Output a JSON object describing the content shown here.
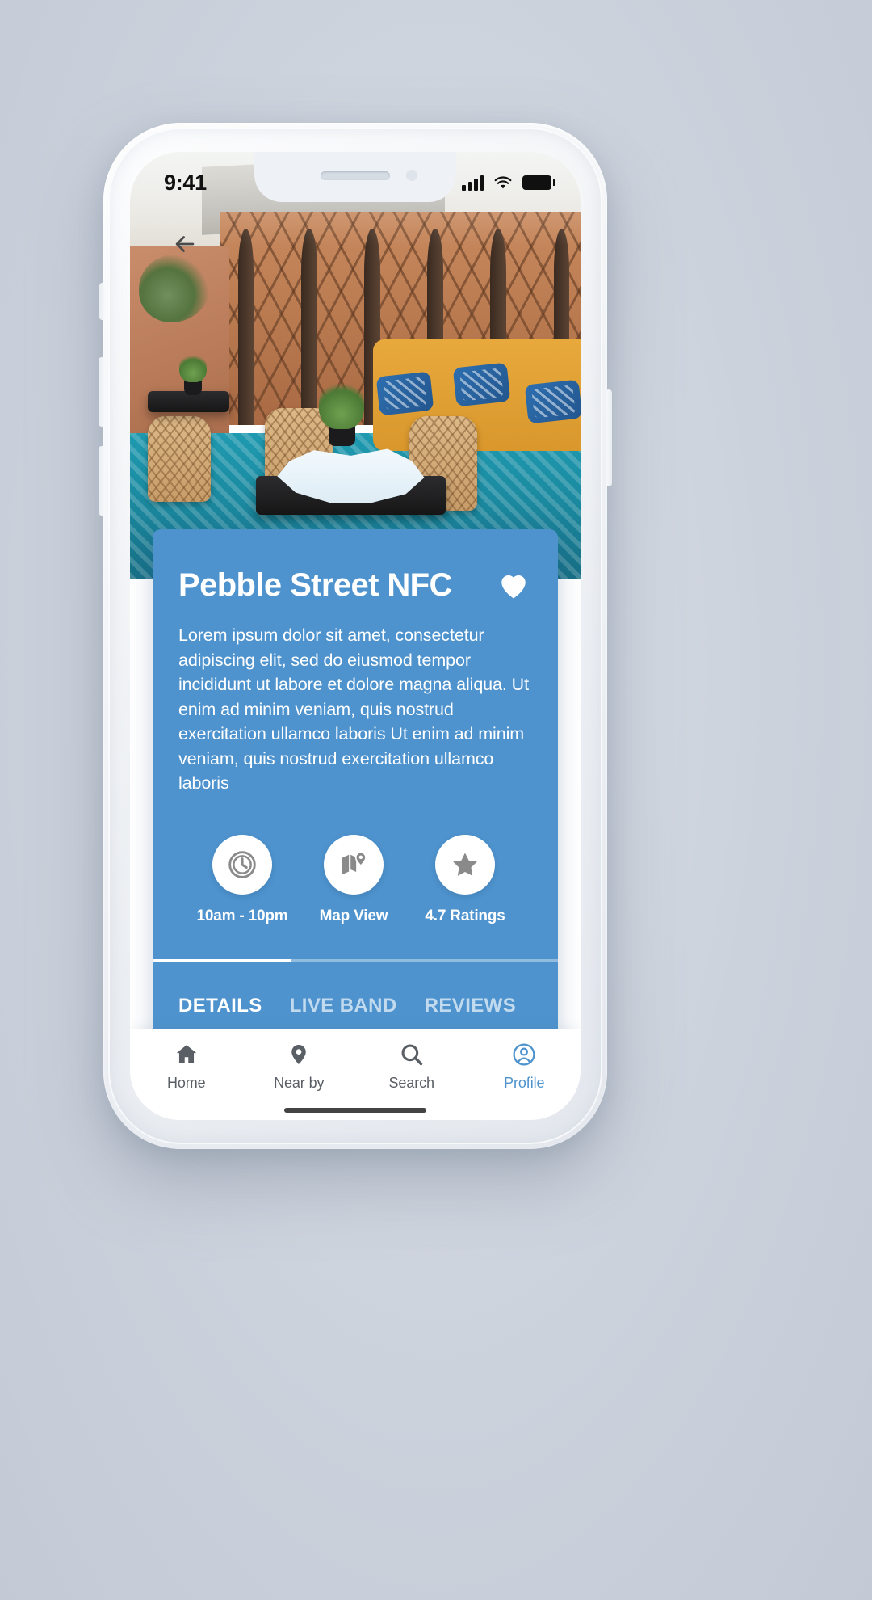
{
  "status_bar": {
    "time": "9:41",
    "icons": [
      "signal-bars-icon",
      "wifi-icon",
      "battery-icon"
    ]
  },
  "header": {
    "back_icon": "arrow-left-icon"
  },
  "hero": {
    "image_alt": "restaurant terrace with rattan chairs, blue pillows and patterned tile floor"
  },
  "card": {
    "title": "Pebble Street NFC",
    "favorite_icon": "heart-icon",
    "description": "Lorem ipsum dolor sit amet, consectetur adipiscing elit, sed do eiusmod tempor incididunt ut labore et dolore magna aliqua. Ut enim ad minim veniam, quis nostrud exercitation ullamco laboris Ut enim ad minim veniam, quis nostrud exercitation ullamco laboris",
    "accent_color": "#4e93ce",
    "info": [
      {
        "icon": "clock-icon",
        "label": "10am - 10pm"
      },
      {
        "icon": "map-pin-icon",
        "label": "Map View"
      },
      {
        "icon": "star-icon",
        "label": "4.7 Ratings"
      }
    ],
    "tabs": [
      {
        "label": "DETAILS",
        "active": true
      },
      {
        "label": "LIVE BAND",
        "active": false
      },
      {
        "label": "REVIEWS",
        "active": false
      }
    ]
  },
  "bottom_nav": {
    "active_color": "#4e93ce",
    "items": [
      {
        "label": "Home",
        "icon": "home-icon",
        "active": false
      },
      {
        "label": "Near by",
        "icon": "location-pin-icon",
        "active": false
      },
      {
        "label": "Search",
        "icon": "search-icon",
        "active": false
      },
      {
        "label": "Profile",
        "icon": "user-circle-icon",
        "active": true
      }
    ]
  }
}
